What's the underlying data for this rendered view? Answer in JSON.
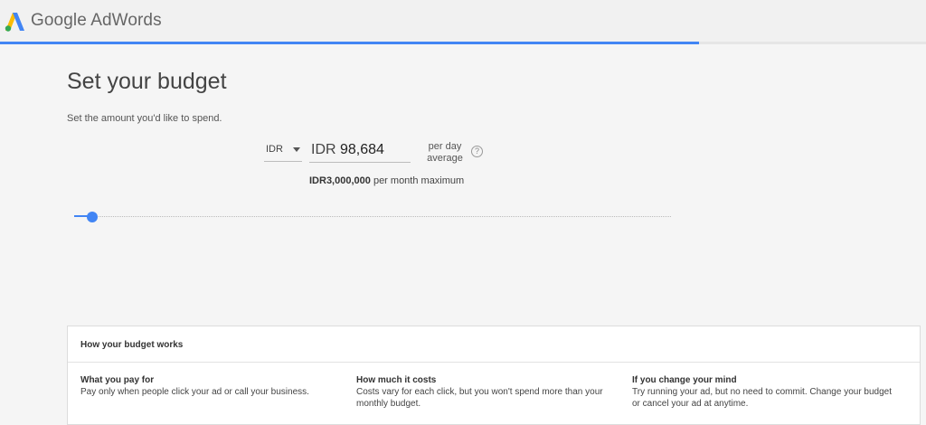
{
  "header": {
    "brand": "Google AdWords",
    "progress_fraction": 0.755,
    "accent_color": "#4285f4"
  },
  "main": {
    "title": "Set your budget",
    "subtitle": "Set the amount you'd like to spend.",
    "currency": {
      "selected": "IDR",
      "icon": "chevron-down-icon"
    },
    "amount": {
      "prefix": "IDR",
      "value": "98,684"
    },
    "per_day_line1": "per day",
    "per_day_line2": "average",
    "help_icon": "?",
    "max_amount": "IDR3,000,000",
    "max_suffix": " per month maximum",
    "slider_fraction": 0.03
  },
  "info": {
    "title": "How your budget works",
    "columns": [
      {
        "title": "What you pay for",
        "text": "Pay only when people click your ad or call your business."
      },
      {
        "title": "How much it costs",
        "text": "Costs vary for each click, but you won't spend more than your monthly budget."
      },
      {
        "title": "If you change your mind",
        "text": "Try running your ad, but no need to commit. Change your budget or cancel your ad at anytime."
      }
    ]
  }
}
